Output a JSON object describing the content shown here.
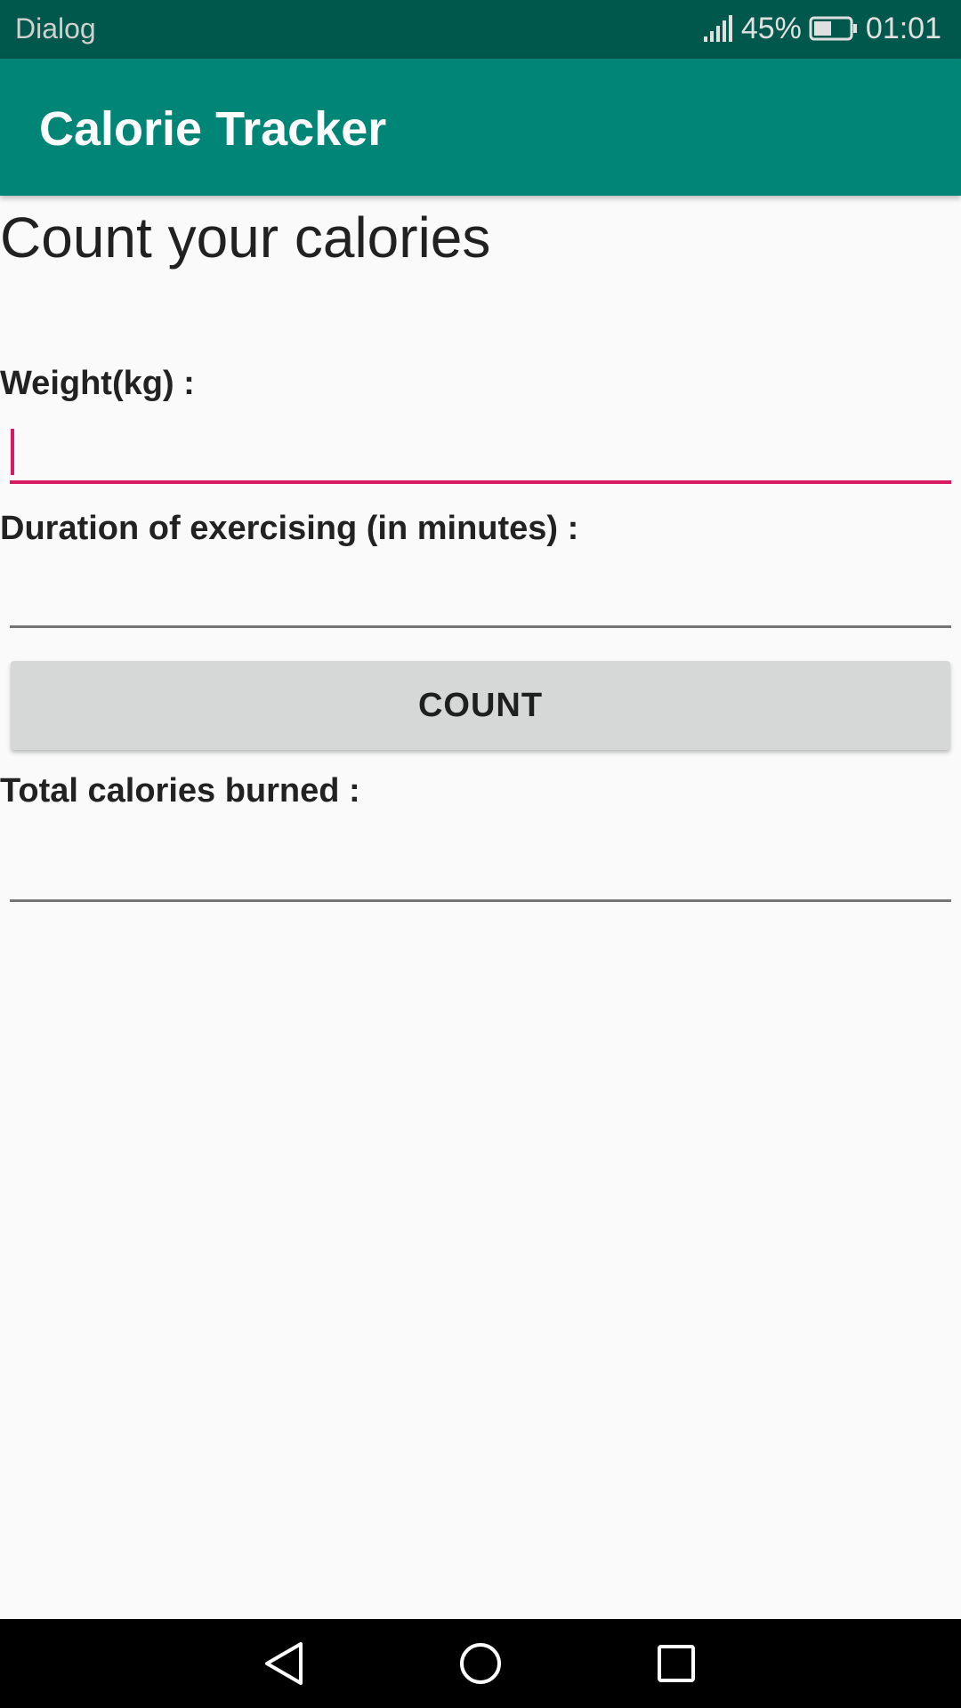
{
  "status_bar": {
    "left_text": "Dialog",
    "battery_percent": "45%",
    "time": "01:01",
    "icons": [
      "signal-icon",
      "battery-icon"
    ]
  },
  "app_bar": {
    "title": "Calorie Tracker"
  },
  "main": {
    "headline": "Count your calories",
    "weight_label": "Weight(kg) :",
    "weight_value": "",
    "duration_label": "Duration of exercising (in minutes) :",
    "duration_value": "",
    "count_button": "COUNT",
    "total_label": "Total calories burned :",
    "total_value": ""
  },
  "nav_bar": {
    "icons": [
      "back-icon",
      "home-icon",
      "recents-icon"
    ]
  },
  "colors": {
    "status_bar": "#00574b",
    "app_bar": "#008577",
    "accent": "#d81b60",
    "background": "#fafafa",
    "button": "#d6d7d7"
  }
}
